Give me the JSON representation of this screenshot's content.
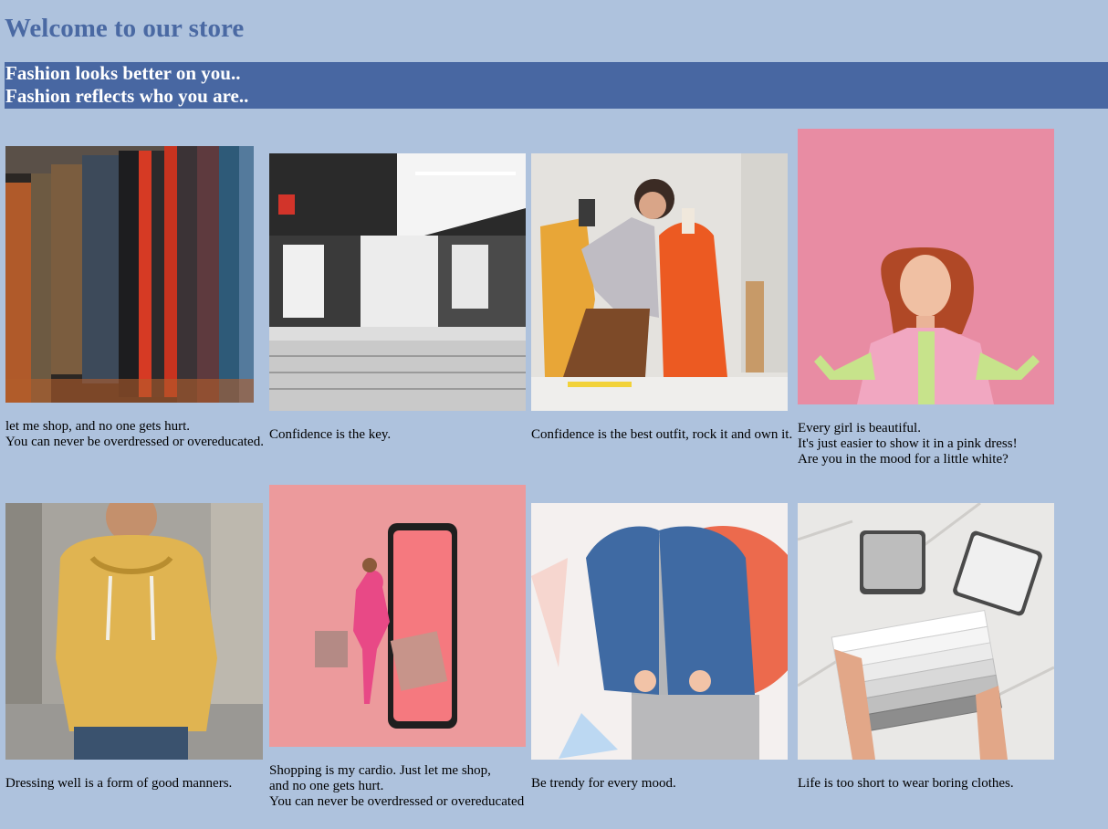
{
  "header": {
    "title": "Welcome to our store",
    "tagline_lines": [
      "Fashion looks better on you..",
      "Fashion reflects who you are.."
    ]
  },
  "gallery": {
    "rows": [
      {
        "items": [
          {
            "image": "clothing-rack-jackets-image",
            "caption_lines": [
              "let me shop, and no one gets hurt.",
              "You can never be overdressed or overeducated."
            ]
          },
          {
            "image": "store-interior-aisle-image",
            "caption_lines": [
              "Confidence is the key."
            ]
          },
          {
            "image": "tailor-fitting-mannequin-image",
            "caption_lines": [
              "Confidence is the best outfit, rock it and own it."
            ]
          },
          {
            "image": "redhead-woman-pink-jacket-image",
            "caption_lines": [
              "Every girl is beautiful.",
              "It's just easier to show it in a pink dress!",
              "Are you in the mood for a little white?"
            ]
          }
        ]
      },
      {
        "items": [
          {
            "image": "man-yellow-hoodie-image",
            "caption_lines": [
              "Dressing well is a form of good manners."
            ]
          },
          {
            "image": "woman-shopping-bags-phone-image",
            "caption_lines": [
              "Shopping is my cardio. Just let me shop,",
              "and no one gets hurt.",
              "You can never be overdressed or overeducated"
            ]
          },
          {
            "image": "kid-denim-jacket-image",
            "caption_lines": [
              "Be trendy for every mood."
            ]
          },
          {
            "image": "folded-white-clothes-image",
            "caption_lines": [
              "Life is too short to wear boring clothes."
            ]
          }
        ]
      }
    ]
  }
}
